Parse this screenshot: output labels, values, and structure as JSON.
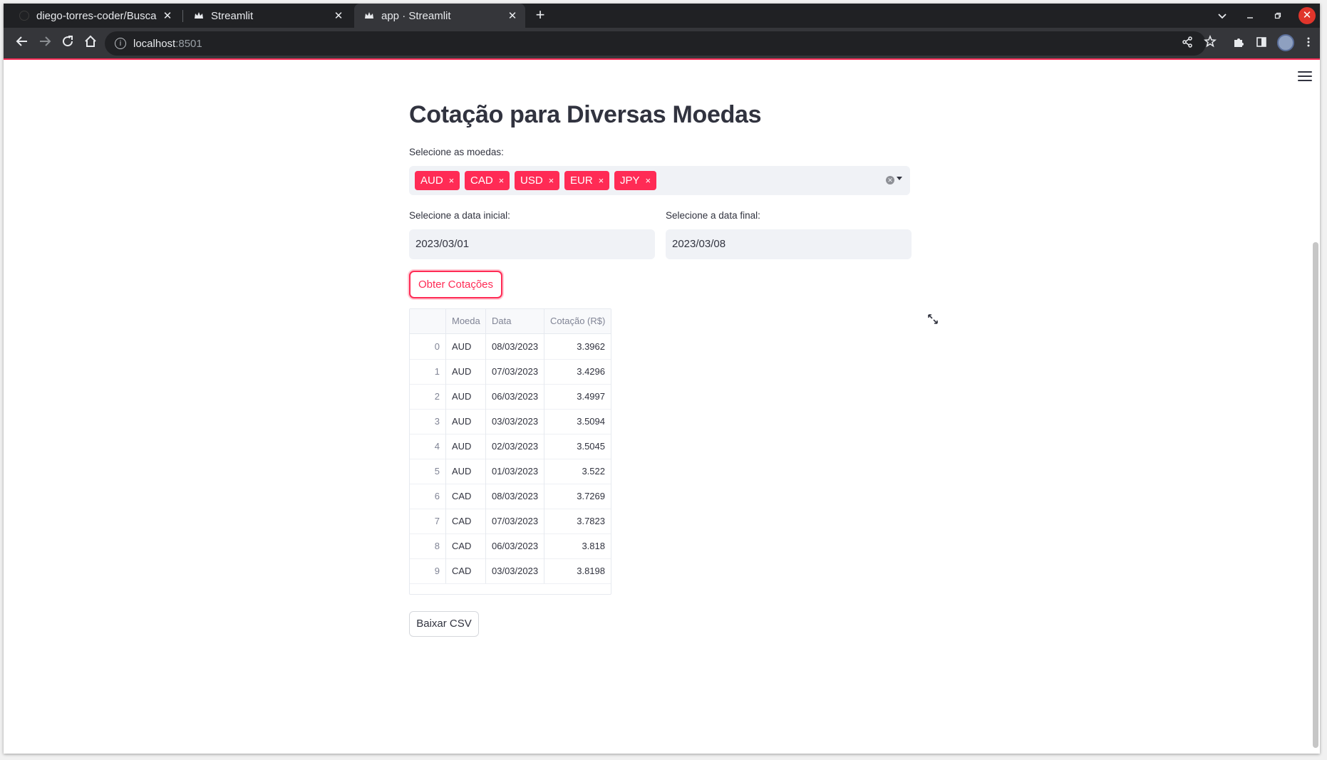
{
  "browser": {
    "tabs": [
      {
        "title": "diego-torres-coder/Busca",
        "active": false
      },
      {
        "title": "Streamlit",
        "active": false
      },
      {
        "title": "app · Streamlit",
        "active": true
      }
    ],
    "new_tab": "+",
    "url_host": "localhost",
    "url_port": ":8501",
    "colors": {
      "accent": "#ff2b55",
      "tabstrip": "#202124",
      "toolbar": "#35363a"
    }
  },
  "app": {
    "title": "Cotação para Diversas Moedas",
    "currency_label": "Selecione as moedas:",
    "currencies": [
      "AUD",
      "CAD",
      "USD",
      "EUR",
      "JPY"
    ],
    "chip_remove": "×",
    "start_date_label": "Selecione a data inicial:",
    "start_date": "2023/03/01",
    "end_date_label": "Selecione a data final:",
    "end_date": "2023/03/08",
    "fetch_button": "Obter Cotações",
    "download_button": "Baixar CSV",
    "table": {
      "columns": [
        "",
        "Moeda",
        "Data",
        "Cotação (R$)"
      ],
      "rows": [
        [
          "0",
          "AUD",
          "08/03/2023",
          "3.3962"
        ],
        [
          "1",
          "AUD",
          "07/03/2023",
          "3.4296"
        ],
        [
          "2",
          "AUD",
          "06/03/2023",
          "3.4997"
        ],
        [
          "3",
          "AUD",
          "03/03/2023",
          "3.5094"
        ],
        [
          "4",
          "AUD",
          "02/03/2023",
          "3.5045"
        ],
        [
          "5",
          "AUD",
          "01/03/2023",
          "3.522"
        ],
        [
          "6",
          "CAD",
          "08/03/2023",
          "3.7269"
        ],
        [
          "7",
          "CAD",
          "07/03/2023",
          "3.7823"
        ],
        [
          "8",
          "CAD",
          "06/03/2023",
          "3.818"
        ],
        [
          "9",
          "CAD",
          "03/03/2023",
          "3.8198"
        ]
      ]
    }
  }
}
